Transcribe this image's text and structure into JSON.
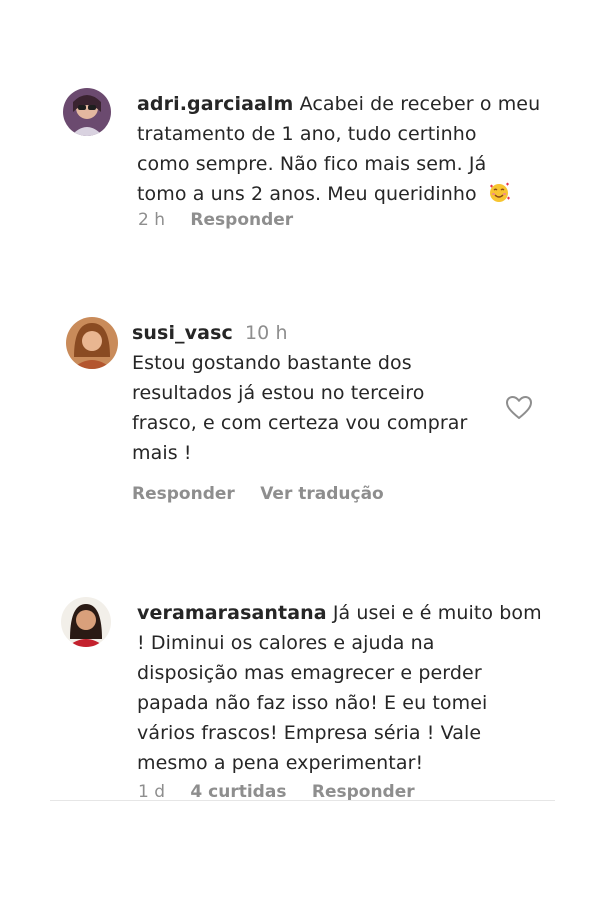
{
  "comments": [
    {
      "username": "adri.garciaalm",
      "lines": [
        "Acabei de receber o meu",
        "tratamento de 1 ano, tudo certinho",
        "como sempre. Não fico mais sem. Já",
        "tomo a uns 2 anos. Meu queridinho"
      ],
      "emoji": "smiling-face-with-hearts-icon",
      "time": "2 h",
      "reply_label": "Responder"
    },
    {
      "username": "susi_vasc",
      "time": "10 h",
      "lines": [
        "Estou gostando bastante dos",
        "resultados já estou no terceiro",
        "frasco, e com certeza vou comprar",
        "mais !"
      ],
      "reply_label": "Responder",
      "translate_label": "Ver tradução",
      "like_icon": "heart-icon"
    },
    {
      "username": "veramarasantana",
      "lines": [
        "Já usei e é muito bom",
        "! Diminui os calores e ajuda na",
        "disposição mas emagrecer e perder",
        "papada não faz isso não! E eu tomei",
        "vários frascos! Empresa séria ! Vale",
        "mesmo a pena experimentar!"
      ],
      "time": "1 d",
      "likes_label": "4 curtidas",
      "reply_label": "Responder"
    }
  ],
  "colors": {
    "text": "#262626",
    "secondary": "#8e8e8e"
  }
}
